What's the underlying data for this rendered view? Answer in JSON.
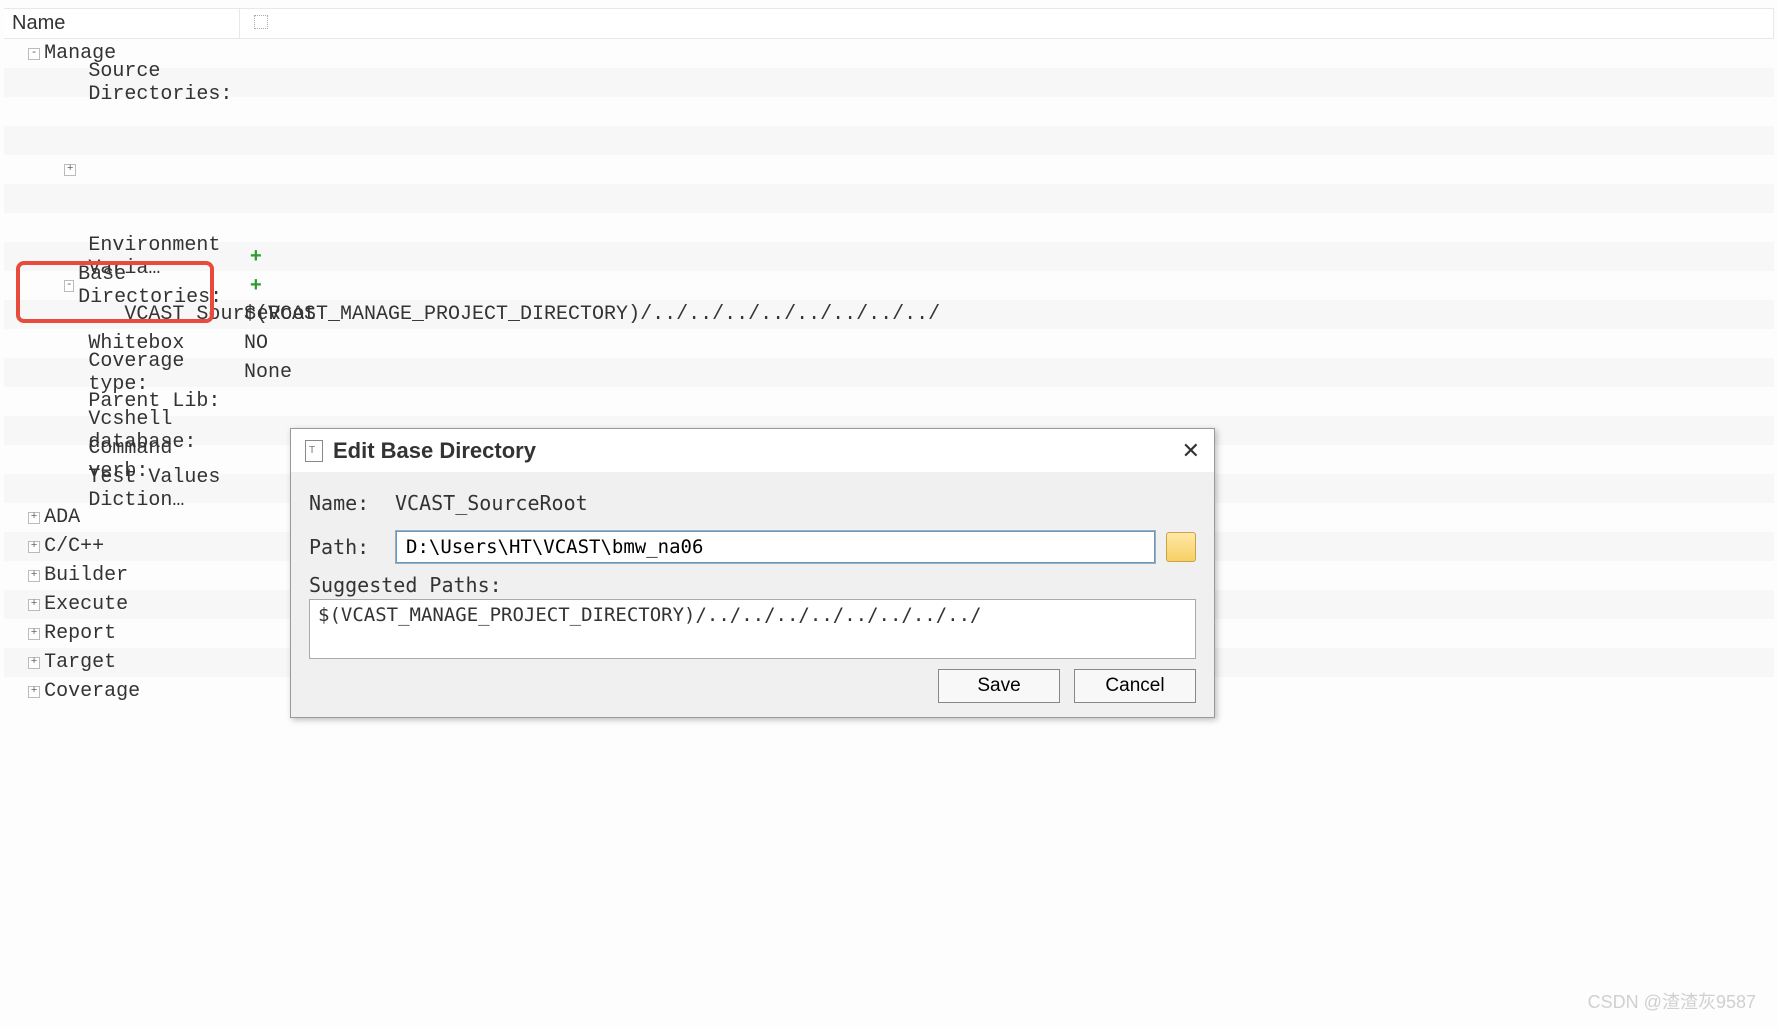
{
  "panel": {
    "header": {
      "name": "Name"
    },
    "rows": [
      {
        "depth": 0,
        "toggle": "-",
        "name": "Manage",
        "value": "",
        "alt": false
      },
      {
        "depth": 1,
        "toggle": "",
        "name": "Source Directories:",
        "value": "",
        "alt": true
      },
      {
        "depth": 1,
        "toggle": "",
        "name": "",
        "value": "",
        "alt": false
      },
      {
        "depth": 1,
        "toggle": "",
        "name": "",
        "value": "",
        "alt": true
      },
      {
        "depth": 1,
        "toggle": "+",
        "name": "",
        "value": "",
        "alt": false
      },
      {
        "depth": 1,
        "toggle": "",
        "name": "",
        "value": "",
        "alt": true
      },
      {
        "depth": 1,
        "toggle": "",
        "name": "",
        "value": "",
        "alt": false
      },
      {
        "depth": 1,
        "toggle": "",
        "name": "Environment Varia…",
        "value": "",
        "add": true,
        "alt": true
      },
      {
        "depth": 1,
        "toggle": "-",
        "name": "Base Directories:",
        "value": "",
        "add": true,
        "alt": false
      },
      {
        "depth": 2,
        "toggle": "",
        "name": "VCAST_SourceRoot",
        "value": "$(VCAST_MANAGE_PROJECT_DIRECTORY)/../../../../../../../../",
        "alt": true
      },
      {
        "depth": 1,
        "toggle": "",
        "name": "Whitebox",
        "value": "NO",
        "alt": false
      },
      {
        "depth": 1,
        "toggle": "",
        "name": "Coverage type:",
        "value": "None",
        "alt": true
      },
      {
        "depth": 1,
        "toggle": "",
        "name": "Parent Lib:",
        "value": "",
        "alt": false
      },
      {
        "depth": 1,
        "toggle": "",
        "name": "Vcshell database:",
        "value": "",
        "alt": true
      },
      {
        "depth": 1,
        "toggle": "",
        "name": "Command verb:",
        "value": "",
        "alt": false
      },
      {
        "depth": 1,
        "toggle": "",
        "name": "Test Values Diction…",
        "value": "",
        "alt": true
      },
      {
        "depth": 0,
        "toggle": "+",
        "name": "ADA",
        "value": "",
        "alt": false
      },
      {
        "depth": 0,
        "toggle": "+",
        "name": "C/C++",
        "value": "",
        "alt": true
      },
      {
        "depth": 0,
        "toggle": "+",
        "name": "Builder",
        "value": "",
        "alt": false
      },
      {
        "depth": 0,
        "toggle": "+",
        "name": "Execute",
        "value": "",
        "alt": true
      },
      {
        "depth": 0,
        "toggle": "+",
        "name": "Report",
        "value": "",
        "alt": false
      },
      {
        "depth": 0,
        "toggle": "+",
        "name": "Target",
        "value": "",
        "alt": true
      },
      {
        "depth": 0,
        "toggle": "+",
        "name": "Coverage",
        "value": "",
        "alt": false
      }
    ]
  },
  "dialog": {
    "title": "Edit Base Directory",
    "name_label": "Name:",
    "name_value": "VCAST_SourceRoot",
    "path_label": "Path:",
    "path_value": "D:\\Users\\HT\\VCAST\\bmw_na06",
    "suggested_label": "Suggested Paths:",
    "suggested_value": "$(VCAST_MANAGE_PROJECT_DIRECTORY)/../../../../../../../../",
    "save": "Save",
    "cancel": "Cancel"
  },
  "watermark": "CSDN @渣渣灰9587"
}
